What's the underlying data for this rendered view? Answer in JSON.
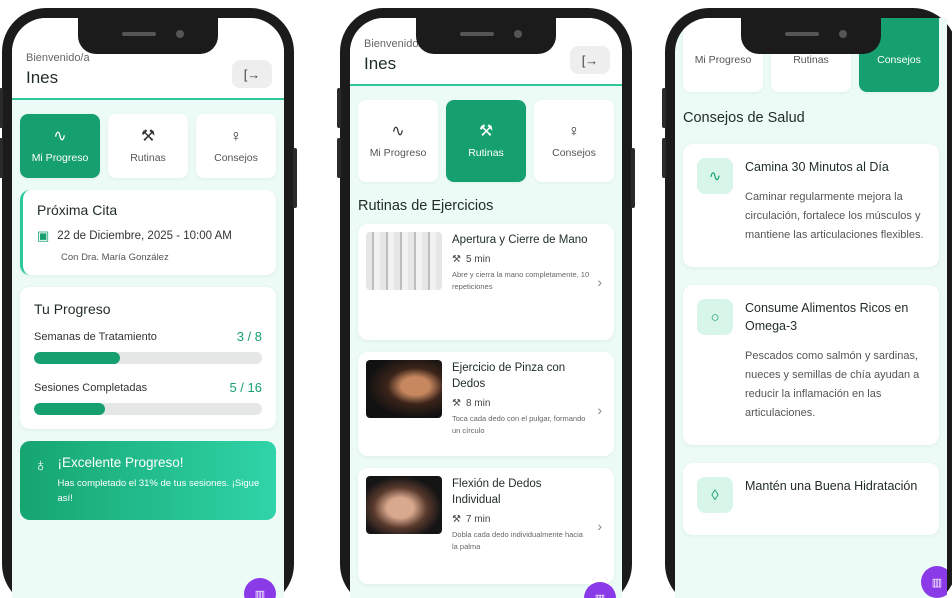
{
  "colors": {
    "primary": "#17a06f",
    "accent": "#2ec99b",
    "fab": "#8b3ae8",
    "background": "#ecfbf6"
  },
  "phone1": {
    "header": {
      "welcome": "Bienvenido/a",
      "username": "Ines"
    },
    "tabs": [
      {
        "label": "Mi Progreso",
        "icon": "activity-icon",
        "active": true
      },
      {
        "label": "Rutinas",
        "icon": "dumbbell-icon",
        "active": false
      },
      {
        "label": "Consejos",
        "icon": "lightbulb-icon",
        "active": false
      }
    ],
    "appointment": {
      "title": "Próxima Cita",
      "date": "22 de Diciembre, 2025 - 10:00 AM",
      "doctor": "Con Dra. María González"
    },
    "progress": {
      "title": "Tu Progreso",
      "items": [
        {
          "label": "Semanas de Tratamiento",
          "value": "3 / 8",
          "fraction": 0.375
        },
        {
          "label": "Sesiones Completadas",
          "value": "5 / 16",
          "fraction": 0.3125
        }
      ]
    },
    "banner": {
      "title": "¡Excelente Progreso!",
      "text": "Has completado el 31% de tus sesiones. ¡Sigue así!"
    }
  },
  "phone2": {
    "header": {
      "welcome": "Bienvenido/a",
      "username": "Ines"
    },
    "tabs": [
      {
        "label": "Mi Progreso",
        "icon": "activity-icon",
        "active": false
      },
      {
        "label": "Rutinas",
        "icon": "dumbbell-icon",
        "active": true
      },
      {
        "label": "Consejos",
        "icon": "lightbulb-icon",
        "active": false
      }
    ],
    "section_title": "Rutinas de Ejercicios",
    "routines": [
      {
        "name": "Apertura y Cierre de Mano",
        "duration": "5 min",
        "description": "Abre y cierra la mano completamente, 10 repeticiones"
      },
      {
        "name": "Ejercicio de Pinza con Dedos",
        "duration": "8 min",
        "description": "Toca cada dedo con el pulgar, formando un círculo"
      },
      {
        "name": "Flexión de Dedos Individual",
        "duration": "7 min",
        "description": "Dobla cada dedo individualmente hacia la palma"
      }
    ]
  },
  "phone3": {
    "tabs": [
      {
        "label": "Mi Progreso",
        "active": false
      },
      {
        "label": "Rutinas",
        "active": false
      },
      {
        "label": "Consejos",
        "active": true
      }
    ],
    "section_title": "Consejos de Salud",
    "tips": [
      {
        "name": "Camina 30 Minutos al Día",
        "icon": "activity-icon",
        "description": "Caminar regularmente mejora la circulación, fortalece los músculos y mantiene las articulaciones flexibles."
      },
      {
        "name": "Consume Alimentos Ricos en Omega-3",
        "icon": "apple-icon",
        "description": "Pescados como salmón y sardinas, nueces y semillas de chía ayudan a reducir la inflamación en las articulaciones."
      },
      {
        "name": "Mantén una Buena Hidratación",
        "icon": "droplets-icon",
        "description": ""
      }
    ]
  }
}
